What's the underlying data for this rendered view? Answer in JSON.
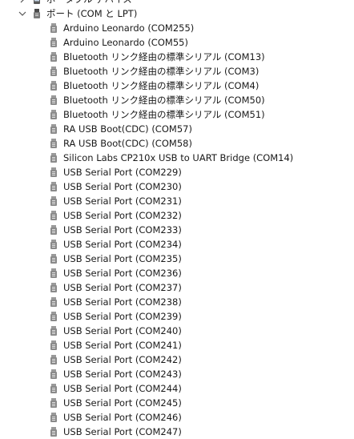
{
  "tree": {
    "items": [
      {
        "label": "ポータブル デバイス",
        "expanded": false,
        "icon": "portable-device-icon"
      },
      {
        "label": "ポート (COM と LPT)",
        "expanded": true,
        "icon": "port-icon",
        "children": [
          "Arduino Leonardo (COM255)",
          "Arduino Leonardo (COM55)",
          "Bluetooth リンク経由の標準シリアル (COM13)",
          "Bluetooth リンク経由の標準シリアル (COM3)",
          "Bluetooth リンク経由の標準シリアル (COM4)",
          "Bluetooth リンク経由の標準シリアル (COM50)",
          "Bluetooth リンク経由の標準シリアル (COM51)",
          "RA USB Boot(CDC) (COM57)",
          "RA USB Boot(CDC) (COM58)",
          "Silicon Labs CP210x USB to UART Bridge (COM14)",
          "USB Serial Port (COM229)",
          "USB Serial Port (COM230)",
          "USB Serial Port (COM231)",
          "USB Serial Port (COM232)",
          "USB Serial Port (COM233)",
          "USB Serial Port (COM234)",
          "USB Serial Port (COM235)",
          "USB Serial Port (COM236)",
          "USB Serial Port (COM237)",
          "USB Serial Port (COM238)",
          "USB Serial Port (COM239)",
          "USB Serial Port (COM240)",
          "USB Serial Port (COM241)",
          "USB Serial Port (COM242)",
          "USB Serial Port (COM243)",
          "USB Serial Port (COM244)",
          "USB Serial Port (COM245)",
          "USB Serial Port (COM246)",
          "USB Serial Port (COM247)"
        ]
      }
    ]
  },
  "colors": {
    "text": "#1a1a1a",
    "icon_body": "#8a8a8a",
    "icon_dark": "#4a4a4a",
    "chevron": "#555555"
  }
}
